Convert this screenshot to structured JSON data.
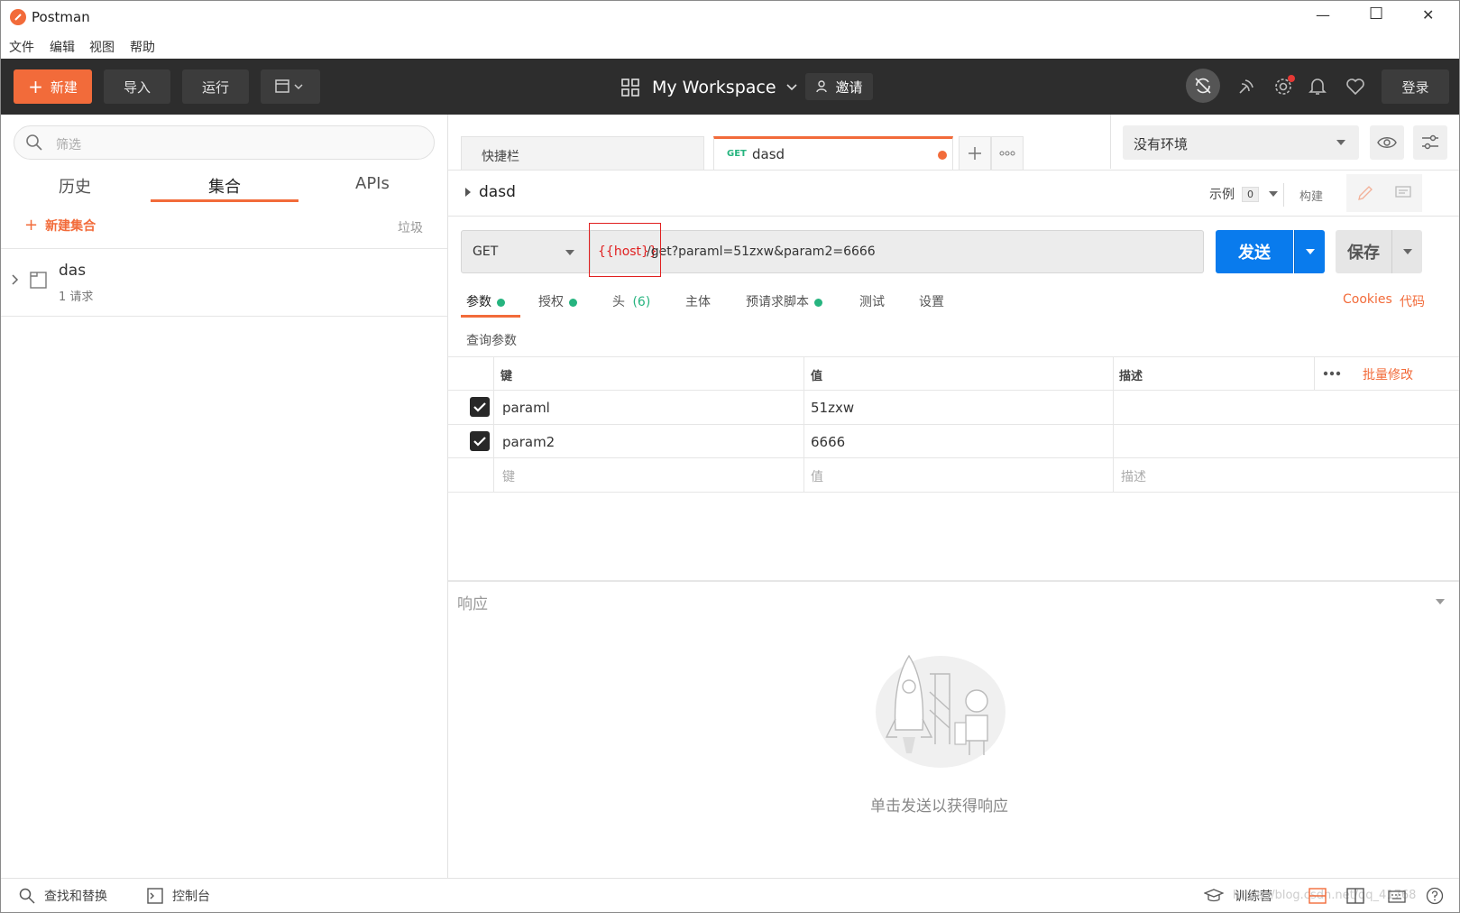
{
  "window": {
    "title": "Postman",
    "minimize": "—",
    "maximize": "☐",
    "close": "✕"
  },
  "menu": [
    "文件",
    "编辑",
    "视图",
    "帮助"
  ],
  "toolbar": {
    "new_label": "新建",
    "import_label": "导入",
    "runner_label": "运行",
    "workspace_label": "My Workspace",
    "invite_label": "邀请",
    "login_label": "登录"
  },
  "sidebar": {
    "search_placeholder": "筛选",
    "tabs": [
      "历史",
      "集合",
      "APIs"
    ],
    "active_tab": "集合",
    "new_collection": "新建集合",
    "trash": "垃圾",
    "collections": [
      {
        "name": "das",
        "count": "1 请求"
      }
    ]
  },
  "tabs": {
    "launchpad": "快捷栏",
    "active": {
      "method": "GET",
      "name": "dasd"
    }
  },
  "environment": {
    "selected": "没有环境"
  },
  "request": {
    "name": "dasd",
    "examples_label": "示例",
    "examples_count": "0",
    "build_label": "构建",
    "method": "GET",
    "url_var": "{{host}}",
    "url_rest": "/get?paraml=51zxw&param2=6666",
    "send_label": "发送",
    "save_label": "保存"
  },
  "req_tabs": {
    "params": "参数",
    "auth": "授权",
    "headers": "头",
    "headers_count": "(6)",
    "body": "主体",
    "prerequest": "预请求脚本",
    "tests": "测试",
    "settings": "设置",
    "cookies": "Cookies",
    "code": "代码"
  },
  "params": {
    "section_title": "查询参数",
    "headers": {
      "key": "键",
      "value": "值",
      "description": "描述",
      "bulk_edit": "批量修改"
    },
    "rows": [
      {
        "key": "paraml",
        "value": "51zxw",
        "checked": true
      },
      {
        "key": "param2",
        "value": "6666",
        "checked": true
      }
    ],
    "placeholder": {
      "key": "键",
      "value": "值",
      "description": "描述"
    }
  },
  "response": {
    "title": "响应",
    "empty_message": "单击发送以获得响应"
  },
  "statusbar": {
    "find_replace": "查找和替换",
    "console": "控制台",
    "bootcamp": "训练营",
    "watermark": "https://blog.csdn.net/qq_41768"
  },
  "colors": {
    "accent": "#f26b3a",
    "send": "#097bed",
    "green": "#26b47f",
    "toolbar": "#2d2d2d",
    "highlight_box": "#e02020"
  }
}
